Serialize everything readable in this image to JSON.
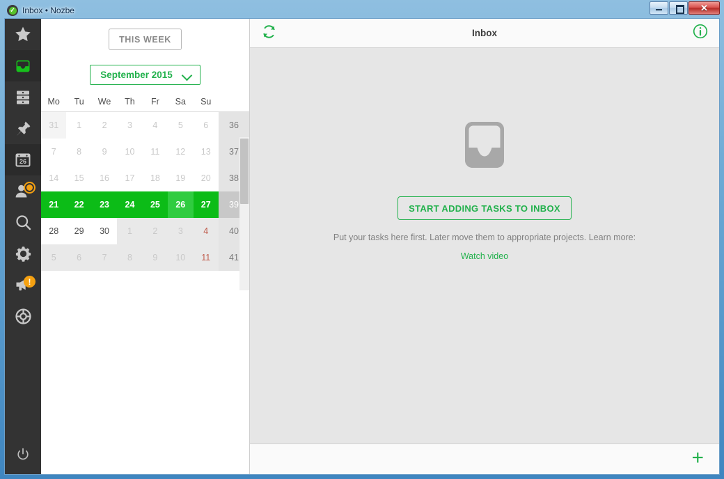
{
  "window": {
    "title": "Inbox • Nozbe",
    "app_icon": "nozbe-check-icon",
    "controls": {
      "minimize": "minimize-button",
      "maximize": "maximize-button",
      "close_glyph": "✕"
    }
  },
  "sidebar": {
    "items": [
      {
        "name": "priority",
        "icon": "star-icon",
        "active": false,
        "badge": null
      },
      {
        "name": "inbox",
        "icon": "inbox-icon",
        "active": true,
        "badge": null
      },
      {
        "name": "projects",
        "icon": "projects-icon",
        "active": false,
        "badge": null
      },
      {
        "name": "labels",
        "icon": "pin-icon",
        "active": false,
        "badge": null
      },
      {
        "name": "calendar",
        "icon": "calendar-icon",
        "active": true,
        "badge": null,
        "day": "26"
      },
      {
        "name": "contacts",
        "icon": "contacts-icon",
        "active": false,
        "badge": "target-badge"
      },
      {
        "name": "search",
        "icon": "search-icon",
        "active": false,
        "badge": null
      },
      {
        "name": "settings",
        "icon": "gear-icon",
        "active": false,
        "badge": null
      },
      {
        "name": "news",
        "icon": "megaphone-icon",
        "active": false,
        "badge": "alert-badge"
      },
      {
        "name": "help",
        "icon": "lifebuoy-icon",
        "active": false,
        "badge": null
      }
    ],
    "logout": {
      "name": "logout",
      "icon": "power-icon"
    }
  },
  "calendar": {
    "this_week_label": "THIS WEEK",
    "month_label": "September 2015",
    "month_chevron": "chevron-down-icon",
    "weekday_headers": [
      "Mo",
      "Tu",
      "We",
      "Th",
      "Fr",
      "Sa",
      "Su"
    ],
    "week_number_header": "",
    "rows": [
      {
        "week": "36",
        "selected": false,
        "days": [
          {
            "n": "31",
            "state": "past-other"
          },
          {
            "n": "1",
            "state": "past"
          },
          {
            "n": "2",
            "state": "past"
          },
          {
            "n": "3",
            "state": "past"
          },
          {
            "n": "4",
            "state": "past"
          },
          {
            "n": "5",
            "state": "past"
          },
          {
            "n": "6",
            "state": "past"
          }
        ]
      },
      {
        "week": "37",
        "selected": false,
        "days": [
          {
            "n": "7",
            "state": "past"
          },
          {
            "n": "8",
            "state": "past"
          },
          {
            "n": "9",
            "state": "past"
          },
          {
            "n": "10",
            "state": "past"
          },
          {
            "n": "11",
            "state": "past"
          },
          {
            "n": "12",
            "state": "past"
          },
          {
            "n": "13",
            "state": "past"
          }
        ]
      },
      {
        "week": "38",
        "selected": false,
        "days": [
          {
            "n": "14",
            "state": "past"
          },
          {
            "n": "15",
            "state": "past"
          },
          {
            "n": "16",
            "state": "past"
          },
          {
            "n": "17",
            "state": "past"
          },
          {
            "n": "18",
            "state": "past"
          },
          {
            "n": "19",
            "state": "past"
          },
          {
            "n": "20",
            "state": "past"
          }
        ]
      },
      {
        "week": "39",
        "selected": true,
        "days": [
          {
            "n": "21",
            "state": "selected"
          },
          {
            "n": "22",
            "state": "selected"
          },
          {
            "n": "23",
            "state": "selected"
          },
          {
            "n": "24",
            "state": "selected"
          },
          {
            "n": "25",
            "state": "selected"
          },
          {
            "n": "26",
            "state": "today"
          },
          {
            "n": "27",
            "state": "selected"
          }
        ]
      },
      {
        "week": "40",
        "selected": false,
        "days": [
          {
            "n": "28",
            "state": "normal"
          },
          {
            "n": "29",
            "state": "normal"
          },
          {
            "n": "30",
            "state": "normal"
          },
          {
            "n": "1",
            "state": "next"
          },
          {
            "n": "2",
            "state": "next"
          },
          {
            "n": "3",
            "state": "next"
          },
          {
            "n": "4",
            "state": "next-sunday"
          }
        ]
      },
      {
        "week": "41",
        "selected": false,
        "days": [
          {
            "n": "5",
            "state": "next"
          },
          {
            "n": "6",
            "state": "next"
          },
          {
            "n": "7",
            "state": "next"
          },
          {
            "n": "8",
            "state": "next"
          },
          {
            "n": "9",
            "state": "next"
          },
          {
            "n": "10",
            "state": "next"
          },
          {
            "n": "11",
            "state": "next-sunday"
          }
        ]
      }
    ]
  },
  "main": {
    "header": {
      "sync_icon": "refresh-icon",
      "title": "Inbox",
      "info_icon": "info-icon"
    },
    "empty_state": {
      "illustration": "inbox-tray-illustration",
      "cta_label": "START ADDING TASKS TO INBOX",
      "hint": "Put your tasks here first. Later move them to appropriate projects. Learn more:",
      "video_link": "Watch video"
    },
    "footer": {
      "add_glyph": "+",
      "add_name": "add-task-button"
    }
  },
  "colors": {
    "brand_green": "#22b14c",
    "selected_green": "#0cbc17",
    "today_green": "#30cc40",
    "badge_orange": "#f5a111",
    "rail_dark": "#333333",
    "content_gray": "#e6e6e6"
  }
}
